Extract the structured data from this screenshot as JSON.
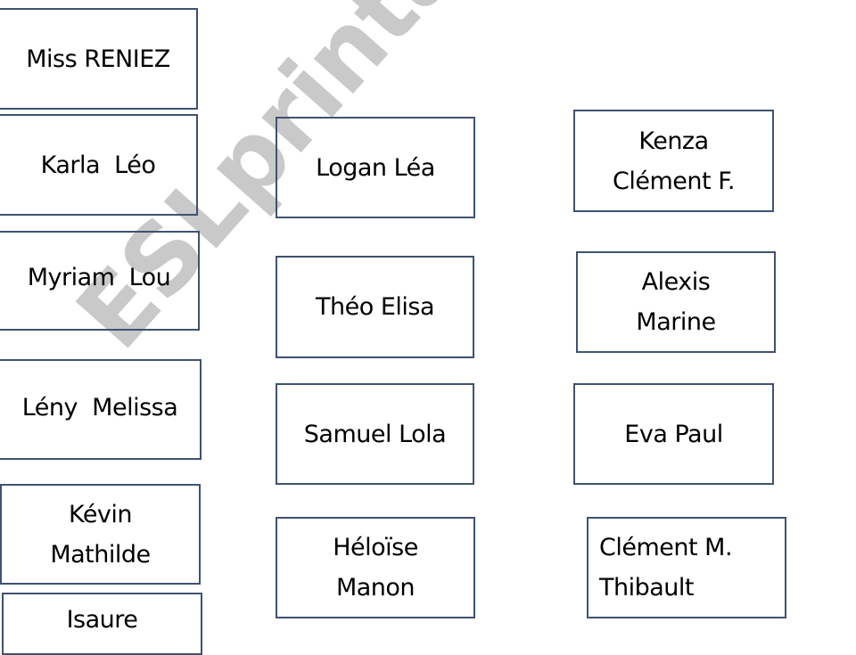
{
  "watermark": {
    "text": "ESLprintables.com",
    "color": "#c9c9c9"
  },
  "border_color": "#3f5270",
  "cards": {
    "left": [
      {
        "label": "Miss RENIEZ"
      },
      {
        "label": "Karla  Léo"
      },
      {
        "label": "Myriam  Lou"
      },
      {
        "label": "Lény  Melissa"
      },
      {
        "label": "Kévin\nMathilde"
      },
      {
        "label": "Isaure"
      }
    ],
    "middle": [
      {
        "label": "Logan Léa"
      },
      {
        "label": "Théo Elisa"
      },
      {
        "label": "Samuel Lola"
      },
      {
        "label": "Héloïse\nManon"
      }
    ],
    "right": [
      {
        "label": "Kenza\nClément F."
      },
      {
        "label": "Alexis\nMarine"
      },
      {
        "label": "Eva Paul"
      },
      {
        "label": "Clément M.\nThibault"
      }
    ]
  }
}
